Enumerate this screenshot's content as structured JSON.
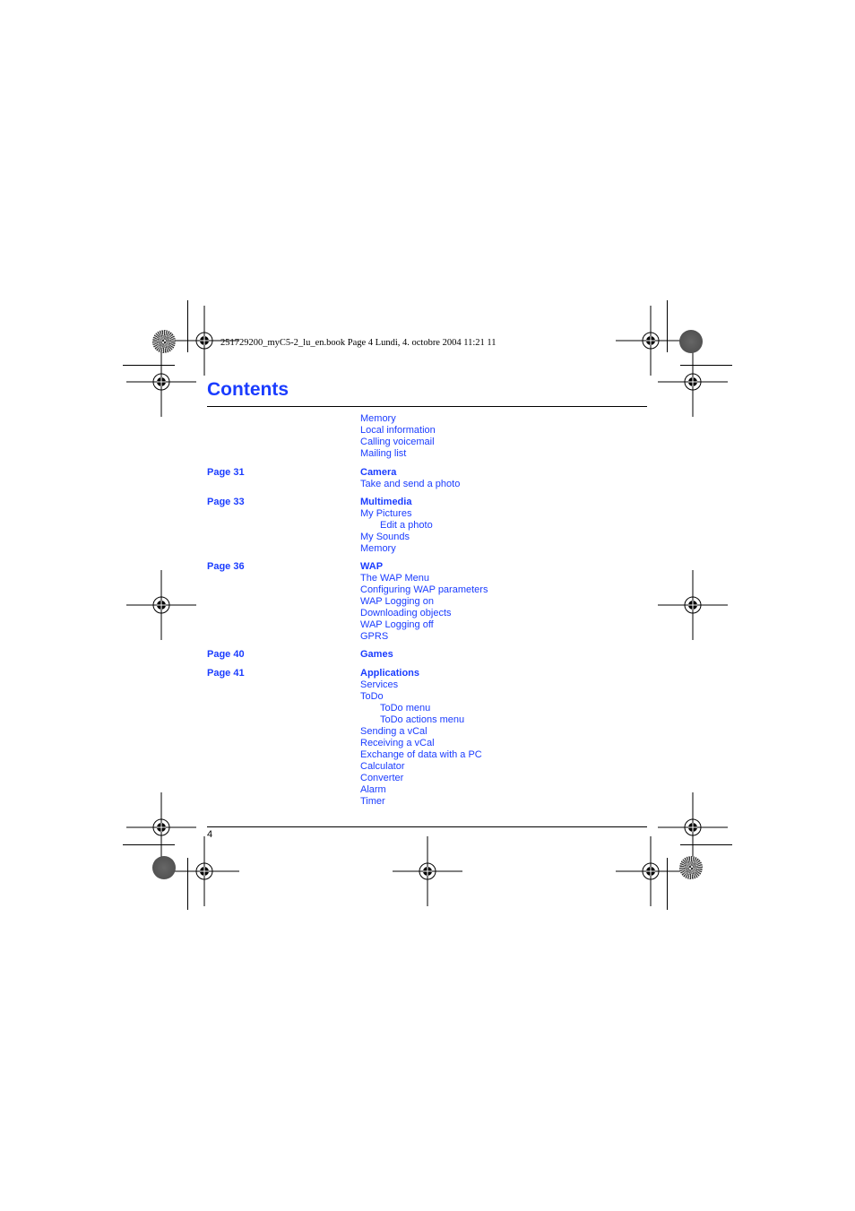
{
  "print_stamp": "251729200_myC5-2_lu_en.book  Page 4  Lundi, 4. octobre 2004  11:21 11",
  "page_title": "Contents",
  "footer_page_number": "4",
  "colors": {
    "accent": "#1a3cff",
    "text": "#000000"
  },
  "sections": [
    {
      "page": "",
      "heading": "",
      "items": [
        {
          "label": "Memory",
          "indent": 0
        },
        {
          "label": "Local information",
          "indent": 0
        },
        {
          "label": "Calling voicemail",
          "indent": 0
        },
        {
          "label": "Mailing list",
          "indent": 0
        }
      ]
    },
    {
      "page": "Page 31",
      "heading": "Camera",
      "items": [
        {
          "label": "Take and send a photo",
          "indent": 0
        }
      ]
    },
    {
      "page": "Page 33",
      "heading": "Multimedia",
      "items": [
        {
          "label": "My Pictures",
          "indent": 0
        },
        {
          "label": "Edit a photo",
          "indent": 1
        },
        {
          "label": "My Sounds",
          "indent": 0
        },
        {
          "label": "Memory",
          "indent": 0
        }
      ]
    },
    {
      "page": "Page 36",
      "heading": "WAP",
      "items": [
        {
          "label": "The WAP Menu",
          "indent": 0
        },
        {
          "label": "Configuring WAP parameters",
          "indent": 0
        },
        {
          "label": "WAP Logging on",
          "indent": 0
        },
        {
          "label": "Downloading objects",
          "indent": 0
        },
        {
          "label": "WAP Logging off",
          "indent": 0
        },
        {
          "label": "GPRS",
          "indent": 0
        }
      ]
    },
    {
      "page": "Page 40",
      "heading": "Games",
      "items": []
    },
    {
      "page": "Page 41",
      "heading": "Applications",
      "items": [
        {
          "label": "Services",
          "indent": 0
        },
        {
          "label": "ToDo",
          "indent": 0
        },
        {
          "label": "ToDo menu",
          "indent": 1
        },
        {
          "label": "ToDo actions menu",
          "indent": 1
        },
        {
          "label": "Sending a vCal",
          "indent": 0
        },
        {
          "label": "Receiving a vCal",
          "indent": 0
        },
        {
          "label": "Exchange of data with a PC",
          "indent": 0
        },
        {
          "label": "Calculator",
          "indent": 0
        },
        {
          "label": "Converter",
          "indent": 0
        },
        {
          "label": "Alarm",
          "indent": 0
        },
        {
          "label": "Timer",
          "indent": 0
        }
      ]
    }
  ]
}
